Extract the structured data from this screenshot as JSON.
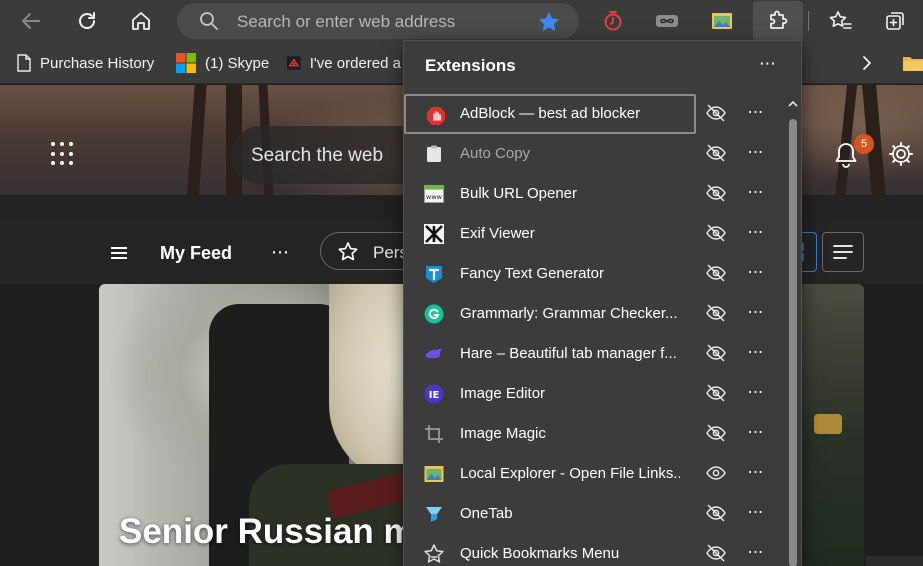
{
  "toolbar": {
    "address_placeholder": "Search or enter web address"
  },
  "favorites": [
    {
      "label": "Purchase History",
      "icon": "document-icon"
    },
    {
      "label": "(1) Skype",
      "icon": "microsoft-logo-icon"
    },
    {
      "label": "I've ordered a",
      "icon": "red-logo-icon"
    }
  ],
  "newtab": {
    "search_placeholder": "Search the web",
    "notification_count": "5",
    "feed_label": "My Feed",
    "personalize_label": "Pers",
    "feed_more": "⋯",
    "headline": "Senior Russian mi"
  },
  "extensions": {
    "title": "Extensions",
    "more": "⋯",
    "items": [
      {
        "label": "AdBlock — best ad blocker",
        "icon": "adblock-hand-icon",
        "dim": false,
        "visible": false
      },
      {
        "label": "Auto Copy",
        "icon": "clipboard-icon",
        "dim": true,
        "visible": false
      },
      {
        "label": "Bulk URL Opener",
        "icon": "www-window-icon",
        "dim": false,
        "visible": false
      },
      {
        "label": "Exif Viewer",
        "icon": "exif-camera-icon",
        "dim": false,
        "visible": false
      },
      {
        "label": "Fancy Text Generator",
        "icon": "fancy-t-icon",
        "dim": false,
        "visible": false
      },
      {
        "label": "Grammarly: Grammar Checker...",
        "icon": "grammarly-icon",
        "dim": false,
        "visible": false
      },
      {
        "label": "Hare – Beautiful tab manager f...",
        "icon": "hare-icon",
        "dim": false,
        "visible": false
      },
      {
        "label": "Image Editor",
        "icon": "ie-icon",
        "dim": false,
        "visible": false
      },
      {
        "label": "Image Magic",
        "icon": "crop-icon",
        "dim": false,
        "visible": false
      },
      {
        "label": "Local Explorer - Open File Links...",
        "icon": "local-explorer-icon",
        "dim": false,
        "visible": true
      },
      {
        "label": "OneTab",
        "icon": "onetab-funnel-icon",
        "dim": false,
        "visible": false
      },
      {
        "label": "Quick Bookmarks Menu",
        "icon": "star-bookmark-icon",
        "dim": false,
        "visible": false
      }
    ]
  },
  "colors": {
    "toolbar_bg": "#3b3b3b",
    "panel_bg": "#3c3c3c",
    "address_star": "#3b8cf0",
    "badge": "#d8541d"
  }
}
